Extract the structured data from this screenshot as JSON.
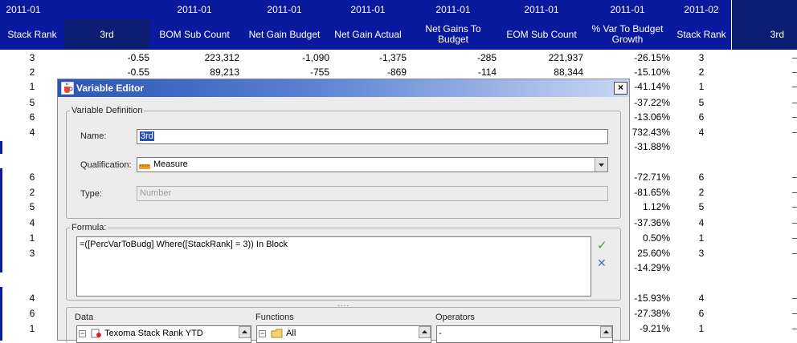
{
  "header": {
    "period_row": [
      "2011-01",
      "2011-01",
      "2011-01",
      "2011-01",
      "2011-01",
      "2011-01",
      "2011-01",
      "2011-02"
    ],
    "columns": [
      "Stack Rank",
      "3rd",
      "BOM Sub Count",
      "Net Gain Budget",
      "Net Gain Actual",
      "Net Gains To Budget",
      "EOM Sub Count",
      "% Var To Budget Growth",
      "Stack Rank",
      "3rd"
    ]
  },
  "rows": [
    {
      "rank": "3",
      "third": "-0.55",
      "bom": "223,312",
      "budget": "-1,090",
      "actual": "-1,375",
      "gains": "-285",
      "eom": "221,937",
      "pct": "-26.15%",
      "rank2": "3"
    },
    {
      "rank": "2",
      "third": "-0.55",
      "bom": "89,213",
      "budget": "-755",
      "actual": "-869",
      "gains": "-114",
      "eom": "88,344",
      "pct": "-15.10%",
      "rank2": "2"
    },
    {
      "rank": "1",
      "pct": "-41.14%",
      "rank2": "1"
    },
    {
      "rank": "5",
      "pct": "-37.22%",
      "rank2": "5"
    },
    {
      "rank": "6",
      "pct": "-13.06%",
      "rank2": "6"
    },
    {
      "rank": "4",
      "pct": "732.43%",
      "rank2": "4"
    },
    {
      "rank": "",
      "pct": "-31.88%",
      "rank2": ""
    },
    {
      "rank": "",
      "pct": "",
      "rank2": ""
    },
    {
      "rank": "6",
      "pct": "-72.71%",
      "rank2": "6"
    },
    {
      "rank": "2",
      "pct": "-81.65%",
      "rank2": "2"
    },
    {
      "rank": "5",
      "pct": "1.12%",
      "rank2": "5"
    },
    {
      "rank": "4",
      "pct": "-37.36%",
      "rank2": "4"
    },
    {
      "rank": "1",
      "pct": "0.50%",
      "rank2": "1"
    },
    {
      "rank": "3",
      "pct": "25.60%",
      "rank2": "3"
    },
    {
      "rank": "",
      "pct": "-14.29%",
      "rank2": ""
    },
    {
      "rank": "",
      "pct": "",
      "rank2": ""
    },
    {
      "rank": "4",
      "pct": "-15.93%",
      "rank2": "4"
    },
    {
      "rank": "6",
      "pct": "-27.38%",
      "rank2": "6"
    },
    {
      "rank": "1",
      "pct": "-9.21%",
      "rank2": "1"
    }
  ],
  "dialog": {
    "title": "Variable Editor",
    "close_label": "×",
    "definition_group": "Variable Definition",
    "name_label": "Name:",
    "name_value": "3rd",
    "qualification_label": "Qualification:",
    "qualification_value": "Measure",
    "type_label": "Type:",
    "type_value": "Number",
    "formula_group": "Formula:",
    "formula_value": "=([PercVarToBudg] Where([StackRank] = 3)) In Block",
    "validate_icon": "✓",
    "cancel_icon": "✕",
    "splitter_grip": "....",
    "panels": {
      "data_label": "Data",
      "functions_label": "Functions",
      "operators_label": "Operators",
      "data_item": "Texoma Stack Rank YTD",
      "functions_item": "All",
      "operators_item": "-",
      "expander": "−"
    }
  },
  "colors": {
    "header_blue": "#0a1a9e",
    "header_dark": "#0d1e72",
    "dialog_bg": "#ececec",
    "title_gradient_start": "#2b55b5"
  }
}
